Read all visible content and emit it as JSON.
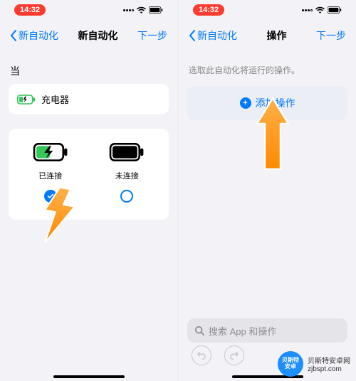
{
  "status": {
    "time": "14:32"
  },
  "left": {
    "nav": {
      "back": "新自动化",
      "title": "新自动化",
      "next": "下一步"
    },
    "section_label": "当",
    "trigger_label": "充电器",
    "options": {
      "connected": "已连接",
      "disconnected": "未连接"
    }
  },
  "right": {
    "nav": {
      "back": "新自动化",
      "title": "操作",
      "next": "下一步"
    },
    "hint": "选取此自动化将运行的操作。",
    "add_action": "添加操作",
    "search_placeholder": "搜索 App 和操作"
  },
  "watermark": {
    "badge": "贝斯特 安卓",
    "line1": "贝斯特安卓网",
    "line2": "zjbspt.com"
  }
}
